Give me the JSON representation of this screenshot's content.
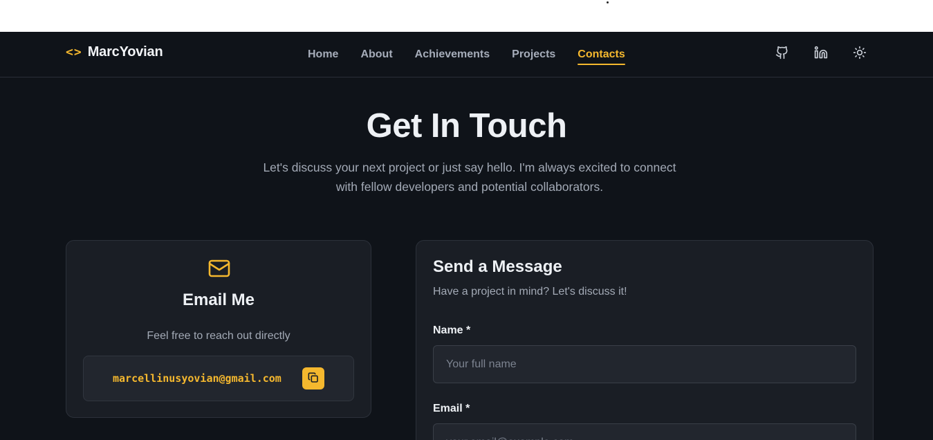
{
  "nav": {
    "brand_icon": "<>",
    "brand_name": "MarcYovian",
    "links": [
      {
        "label": "Home",
        "active": false
      },
      {
        "label": "About",
        "active": false
      },
      {
        "label": "Achievements",
        "active": false
      },
      {
        "label": "Projects",
        "active": false
      },
      {
        "label": "Contacts",
        "active": true
      }
    ],
    "icons": [
      "github-icon",
      "linkedin-icon",
      "sun-icon"
    ]
  },
  "hero": {
    "title": "Get In Touch",
    "subtitle": "Let's discuss your next project or just say hello. I'm always excited to connect with fellow developers and potential collaborators."
  },
  "email_card": {
    "icon": "mail-icon",
    "title": "Email Me",
    "description": "Feel free to reach out directly",
    "address": "marcellinusyovian@gmail.com",
    "copy_icon": "copy-icon"
  },
  "form": {
    "title": "Send a Message",
    "subtitle": "Have a project in mind? Let's discuss it!",
    "name_label": "Name *",
    "name_placeholder": "Your full name",
    "email_label": "Email *",
    "email_placeholder": "your.email@example.com"
  },
  "colors": {
    "background": "#0f1319",
    "card": "#1a1e25",
    "accent": "#f5b82e",
    "text": "#eef1f5",
    "muted": "#a3aab6"
  }
}
